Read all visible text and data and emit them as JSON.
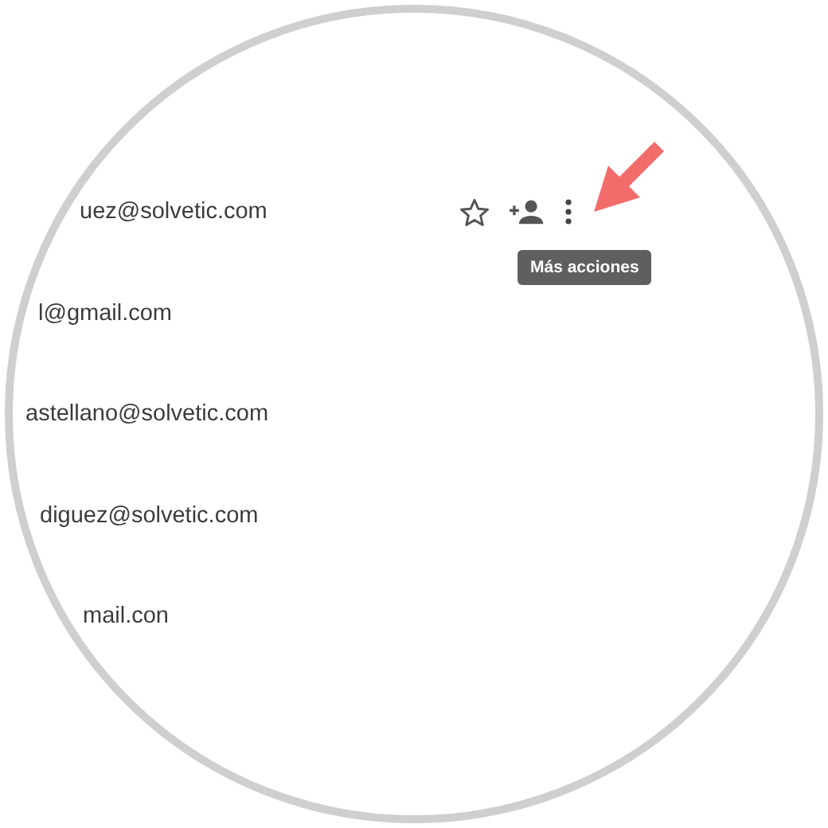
{
  "contacts": [
    {
      "email": "uez@solvetic.com",
      "hovered": true
    },
    {
      "email": "l@gmail.com",
      "hovered": false
    },
    {
      "email": "astellano@solvetic.com",
      "hovered": false
    },
    {
      "email": "diguez@solvetic.com",
      "hovered": false
    },
    {
      "email": "mail.con",
      "hovered": false
    }
  ],
  "tooltip": {
    "text": "Más acciones"
  }
}
